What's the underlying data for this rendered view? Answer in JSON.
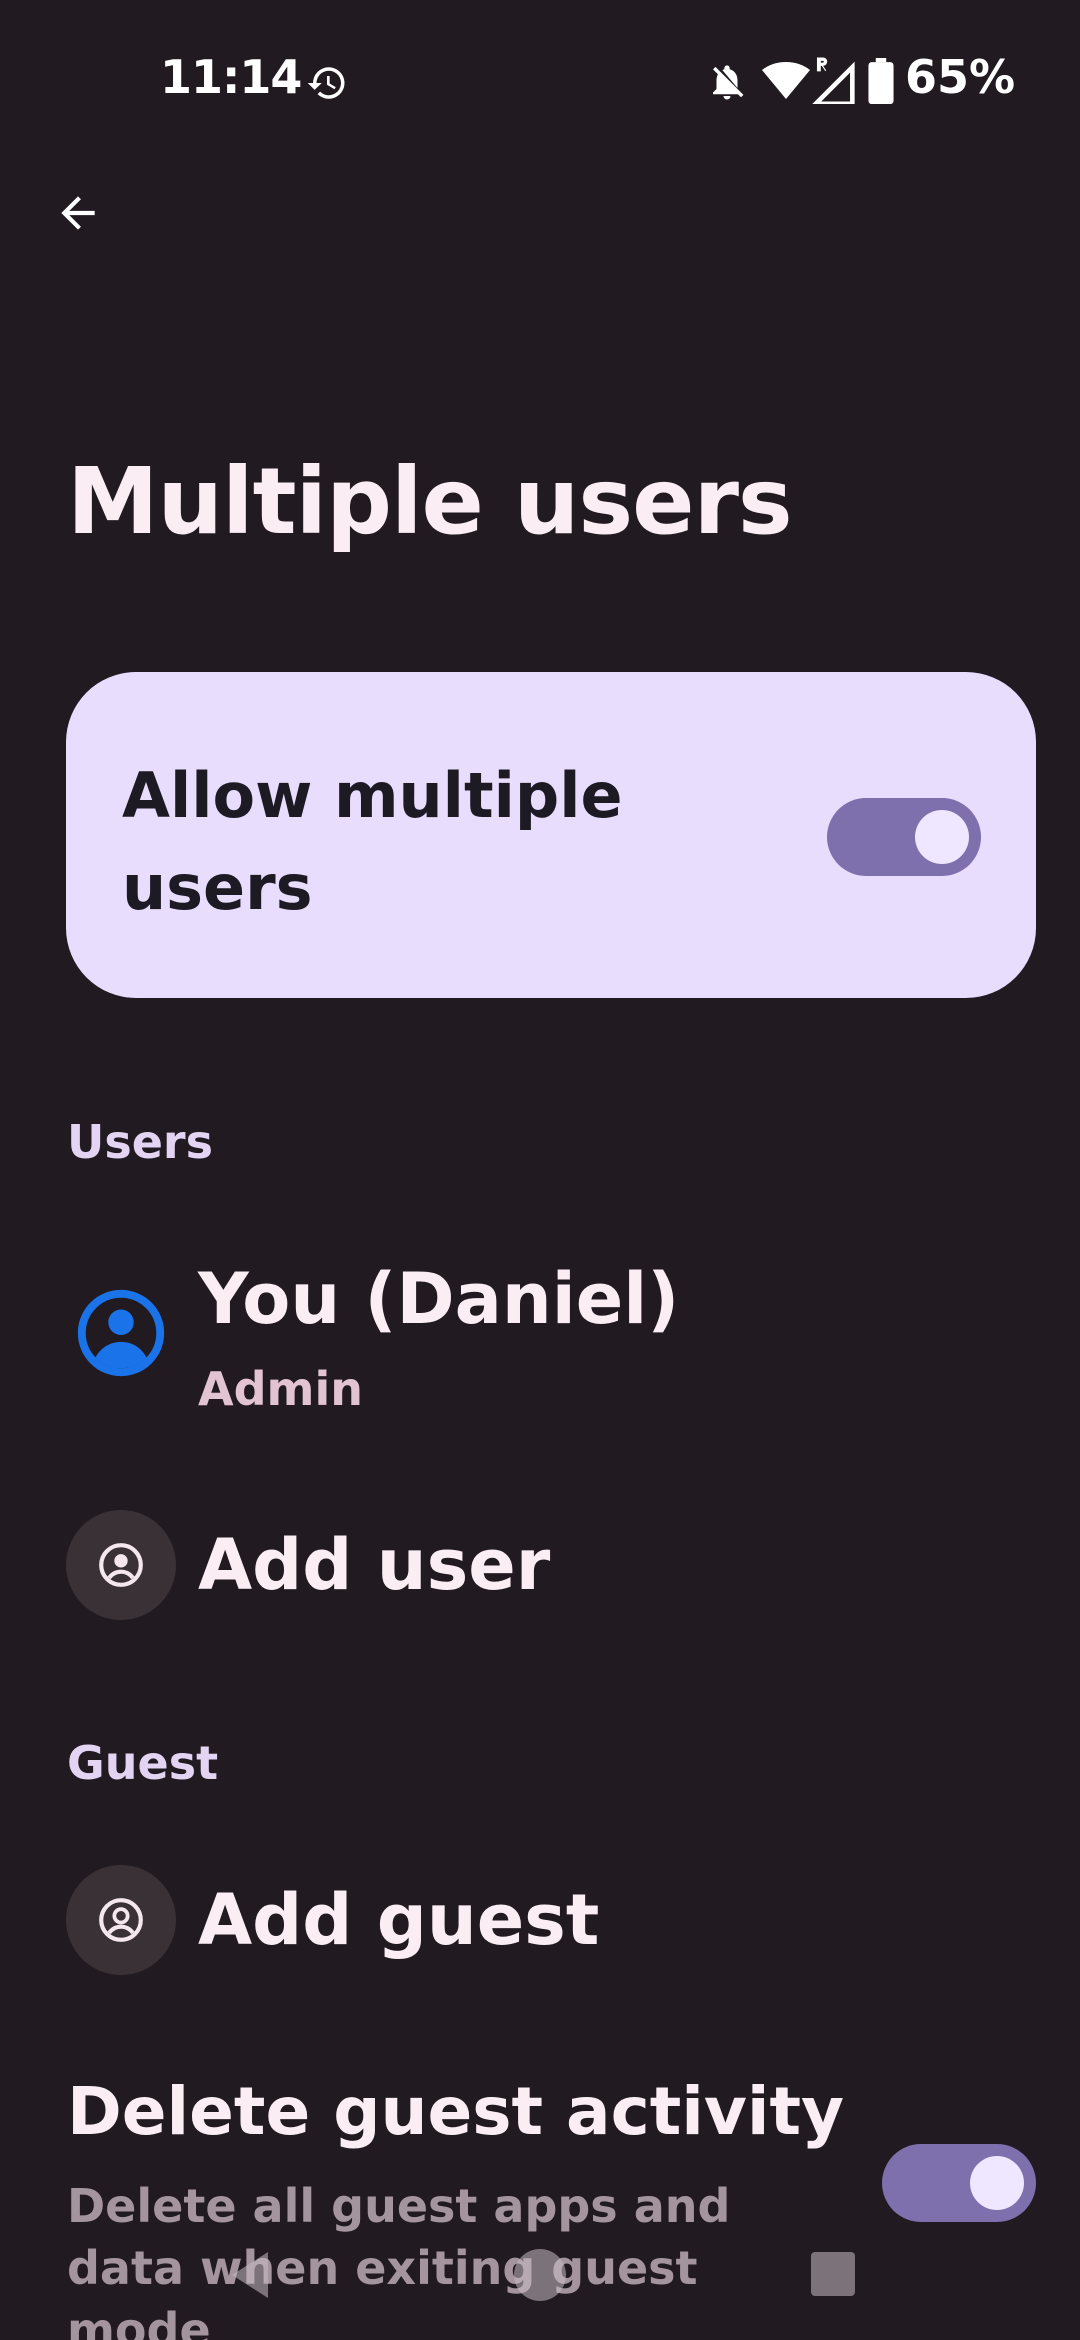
{
  "status_bar": {
    "time": "11:14",
    "battery": "65%",
    "icons": [
      "history-icon",
      "bell-off-icon",
      "wifi-icon",
      "signal-roaming-icon",
      "battery-icon"
    ]
  },
  "header": {
    "back_icon": "arrow-back-icon",
    "title": "Multiple users"
  },
  "main_toggle": {
    "label": "Allow multiple users",
    "enabled": true
  },
  "users_section": {
    "header": "Users",
    "items": [
      {
        "title": "You (Daniel)",
        "subtitle": "Admin",
        "icon": "account-circle-icon"
      },
      {
        "title": "Add user",
        "icon": "account-add-icon"
      }
    ]
  },
  "guest_section": {
    "header": "Guest",
    "add_guest": {
      "title": "Add guest",
      "icon": "guest-icon"
    },
    "delete_guest": {
      "title": "Delete guest activity",
      "subtitle": "Delete all guest apps and data when exiting guest mode",
      "enabled": true
    }
  },
  "nav_bar": {
    "icons": [
      "back-triangle-icon",
      "home-circle-icon",
      "recents-square-icon"
    ]
  },
  "colors": {
    "background": "#211a21",
    "card": "#e9ddfe",
    "switch_track": "#7d70ad",
    "avatar_blue": "#1a73e8"
  }
}
